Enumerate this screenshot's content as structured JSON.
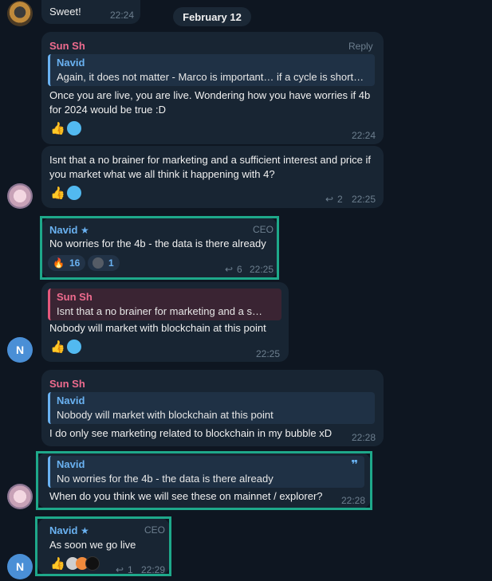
{
  "date_separator": "February 12",
  "messages": [
    {
      "text": "Sweet!",
      "time": "22:24"
    },
    {
      "sender": "Sun Sh",
      "reply_label": "Reply",
      "quote": {
        "name": "Navid",
        "text": "Again, it does not matter - Marco is important… if a cycle is short…"
      },
      "text": "Once you are live, you are live. Wondering how you have worries if 4b for 2024 would be true :D",
      "time": "22:24"
    },
    {
      "text": "Isnt that a no brainer for marketing and a sufficient interest and price if you market what we all think it happening with 4?",
      "replies": "2",
      "time": "22:25"
    },
    {
      "sender": "Navid",
      "role": "CEO",
      "text": "No worries for the 4b - the data is there already",
      "reactions": [
        {
          "emoji": "🔥",
          "count": "16"
        },
        {
          "emoji": "avatar",
          "count": "1"
        }
      ],
      "replies": "6",
      "time": "22:25"
    },
    {
      "quote": {
        "name": "Sun Sh",
        "text": "Isnt that a no brainer for marketing and a s…"
      },
      "text": "Nobody will market with blockchain at this point",
      "time": "22:25"
    },
    {
      "sender": "Sun Sh",
      "quote": {
        "name": "Navid",
        "text": "Nobody will market with blockchain at this point"
      },
      "text": "I do only see marketing related to blockchain in my bubble xD",
      "time": "22:28"
    },
    {
      "quote": {
        "name": "Navid",
        "text": "No worries for the 4b - the data is there already"
      },
      "text": "When do you think we will see these on mainnet / explorer?",
      "time": "22:28"
    },
    {
      "sender": "Navid",
      "role": "CEO",
      "text": "As soon we go live",
      "replies": "1",
      "time": "22:29"
    }
  ],
  "avatars": {
    "navid_initial": "N"
  },
  "colors": {
    "background": "#0e1621",
    "bubble": "#182533",
    "accent_blue": "#6ab2f2",
    "accent_pink": "#ee6b8e",
    "highlight": "#1ea88a"
  }
}
